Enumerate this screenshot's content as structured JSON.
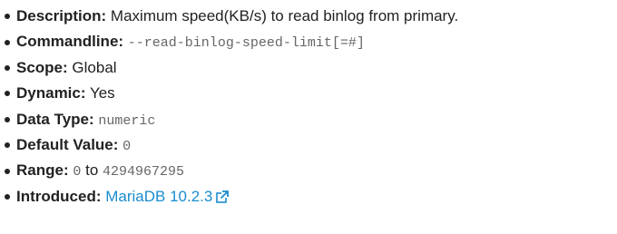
{
  "items": {
    "description": {
      "label": "Description:",
      "text": "Maximum speed(KB/s) to read binlog from primary."
    },
    "commandline": {
      "label": "Commandline:",
      "code": "--read-binlog-speed-limit[=#]"
    },
    "scope": {
      "label": "Scope:",
      "text": "Global"
    },
    "dynamic": {
      "label": "Dynamic:",
      "text": "Yes"
    },
    "data_type": {
      "label": "Data Type:",
      "code": "numeric"
    },
    "default_value": {
      "label": "Default Value:",
      "code": "0"
    },
    "range": {
      "label": "Range:",
      "min": "0",
      "sep": "to",
      "max": "4294967295"
    },
    "introduced": {
      "label": "Introduced:",
      "link_text": "MariaDB 10.2.3"
    }
  },
  "colors": {
    "text": "#222222",
    "code": "#666666",
    "link": "#1a8ccf"
  },
  "icons": {
    "external_link": "external-link-icon"
  }
}
